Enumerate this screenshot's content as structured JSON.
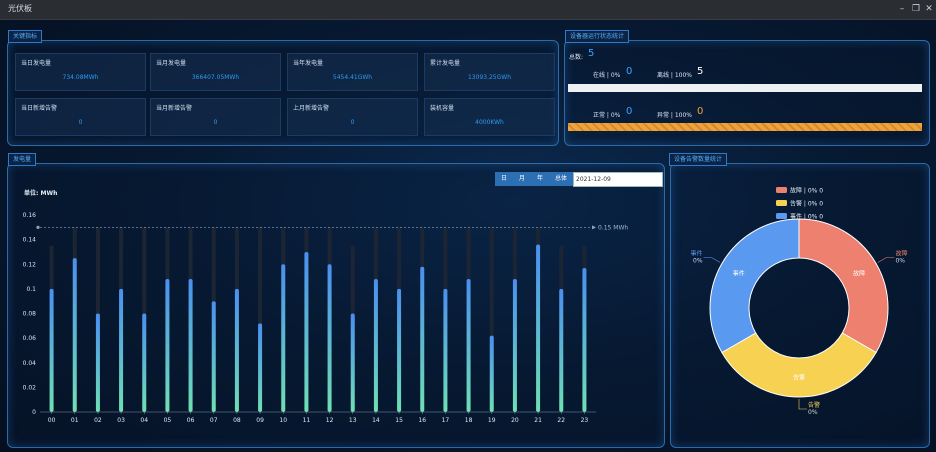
{
  "window": {
    "title": "光伏板"
  },
  "panels": {
    "kpi_title": "关键指标",
    "status_title": "设备器运行状态统计",
    "power_title": "发电量",
    "alarm_title": "设备告警数量统计"
  },
  "kpis": [
    {
      "label": "当日发电量",
      "value": "734.08MWh"
    },
    {
      "label": "当月发电量",
      "value": "366407.05MWh"
    },
    {
      "label": "当年发电量",
      "value": "5454.41GWh"
    },
    {
      "label": "累计发电量",
      "value": "13093.25GWh"
    },
    {
      "label": "当日新增告警",
      "value": "0"
    },
    {
      "label": "当月新增告警",
      "value": "0"
    },
    {
      "label": "上月新增告警",
      "value": "0"
    },
    {
      "label": "装机容量",
      "value": "4000KWh"
    }
  ],
  "status": {
    "total_label": "总数:",
    "total_value": "5",
    "online_label": "在线 | 0%",
    "online_value": "0",
    "offline_label": "离线 | 100%",
    "offline_value": "5",
    "normal_label": "正常 | 0%",
    "normal_value": "0",
    "abnormal_label": "异常 | 100%",
    "abnormal_value": "0",
    "online_fraction": 0.0,
    "abnormal_fraction": 1.0,
    "colors": {
      "online_bar": "#eef1f4",
      "abnormal_bar": "#f0a23a"
    }
  },
  "controls": {
    "day": "日",
    "month": "月",
    "year": "年",
    "total": "总体",
    "date": "2021-12-09"
  },
  "chart_data": [
    {
      "type": "bar",
      "unit_label": "单位: MWh",
      "categories": [
        "00",
        "01",
        "02",
        "03",
        "04",
        "05",
        "06",
        "07",
        "08",
        "09",
        "10",
        "11",
        "12",
        "13",
        "14",
        "15",
        "16",
        "17",
        "18",
        "19",
        "20",
        "21",
        "22",
        "23"
      ],
      "values": [
        0.1,
        0.125,
        0.08,
        0.1,
        0.08,
        0.108,
        0.108,
        0.09,
        0.1,
        0.072,
        0.12,
        0.13,
        0.12,
        0.08,
        0.108,
        0.1,
        0.118,
        0.1,
        0.108,
        0.062,
        0.108,
        0.136,
        0.1,
        0.117
      ],
      "background_values": [
        0.135,
        0.15,
        0.15,
        0.15,
        0.15,
        0.15,
        0.15,
        0.15,
        0.15,
        0.15,
        0.15,
        0.15,
        0.15,
        0.135,
        0.15,
        0.15,
        0.15,
        0.15,
        0.15,
        0.15,
        0.15,
        0.15,
        0.135,
        0.135
      ],
      "yticks": [
        "0",
        "0.02",
        "0.04",
        "0.06",
        "0.08",
        "0.1",
        "0.12",
        "0.14",
        "0.16"
      ],
      "ylim": [
        0,
        0.16
      ],
      "markline": {
        "value": 0.15,
        "label": "0.15 MWh"
      },
      "grid": false,
      "colors": {
        "bar_top": "#4a8ff0",
        "bar_bottom": "#6fe0b4",
        "bg_bar": "#1c2533",
        "markline": "#8aa6c6"
      }
    },
    {
      "type": "pie",
      "legend_position": "top-center",
      "legend": [
        "故障 | 0% 0",
        "告警 | 0% 0",
        "事件 | 0% 0"
      ],
      "slices": [
        {
          "name": "故障",
          "value": 1,
          "color": "#ee8070",
          "outer_label": [
            "故障",
            "0%"
          ]
        },
        {
          "name": "告警",
          "value": 1,
          "color": "#f6d152",
          "outer_label": [
            "告警",
            "0%"
          ]
        },
        {
          "name": "事件",
          "value": 1,
          "color": "#5a99f0",
          "outer_label": [
            "事件",
            "0%"
          ]
        }
      ]
    }
  ]
}
